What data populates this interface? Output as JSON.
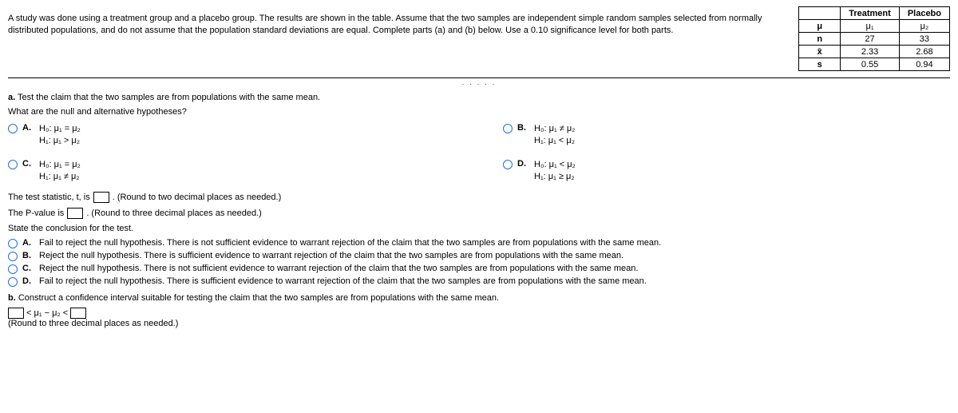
{
  "prompt": "A study was done using a treatment group and a placebo group. The results are shown in the table. Assume that the two samples are independent simple random samples selected from normally distributed populations, and do not assume that the population standard deviations are equal. Complete parts (a) and (b) below. Use a 0.10 significance level for both parts.",
  "table": {
    "headers": {
      "c1": "Treatment",
      "c2": "Placebo"
    },
    "rows": {
      "mu": {
        "label": "μ",
        "c1": "μ₁",
        "c2": "μ₂"
      },
      "n": {
        "label": "n",
        "c1": "27",
        "c2": "33"
      },
      "xbar": {
        "label": "x̄",
        "c1": "2.33",
        "c2": "2.68"
      },
      "s": {
        "label": "s",
        "c1": "0.55",
        "c2": "0.94"
      }
    }
  },
  "partA": {
    "heading_bold": "a.",
    "heading_rest": " Test the claim that the two samples are from populations with the same mean.",
    "subquestion": "What are the null and alternative hypotheses?",
    "options": {
      "A": {
        "label": "A.",
        "line1": "H₀: μ₁ = μ₂",
        "line2": "H₁: μ₁ > μ₂"
      },
      "B": {
        "label": "B.",
        "line1": "H₀: μ₁ ≠ μ₂",
        "line2": "H₁: μ₁ < μ₂"
      },
      "C": {
        "label": "C.",
        "line1": "H₀: μ₁ = μ₂",
        "line2": "H₁: μ₁ ≠ μ₂"
      },
      "D": {
        "label": "D.",
        "line1": "H₀: μ₁ < μ₂",
        "line2": "H₁: μ₁ ≥ μ₂"
      }
    },
    "stat_prefix": "The test statistic, t, is",
    "stat_hint": ". (Round to two decimal places as needed.)",
    "pval_prefix": "The P-value is",
    "pval_hint": ". (Round to three decimal places as needed.)",
    "conclusion_prompt": "State the conclusion for the test.",
    "conclusions": {
      "A": {
        "label": "A.",
        "text": "Fail to reject the null hypothesis. There is not sufficient evidence to warrant rejection of the claim that the two samples are from populations with the same mean."
      },
      "B": {
        "label": "B.",
        "text": "Reject the null hypothesis. There is sufficient evidence to warrant rejection of the claim that the two samples are from populations with the same mean."
      },
      "C": {
        "label": "C.",
        "text": "Reject the null hypothesis. There is not sufficient evidence to warrant rejection of the claim that the two samples are from populations with the same mean."
      },
      "D": {
        "label": "D.",
        "text": "Fail to reject the null hypothesis. There is sufficient evidence to warrant rejection of the claim that the two samples are from populations with the same mean."
      }
    }
  },
  "partB": {
    "heading_bold": "b.",
    "heading_rest": " Construct a confidence interval suitable for testing the claim that the two samples are from populations with the same mean.",
    "ci_mid": "< μ₁ − μ₂ <",
    "hint": "(Round to three decimal places as needed.)"
  }
}
